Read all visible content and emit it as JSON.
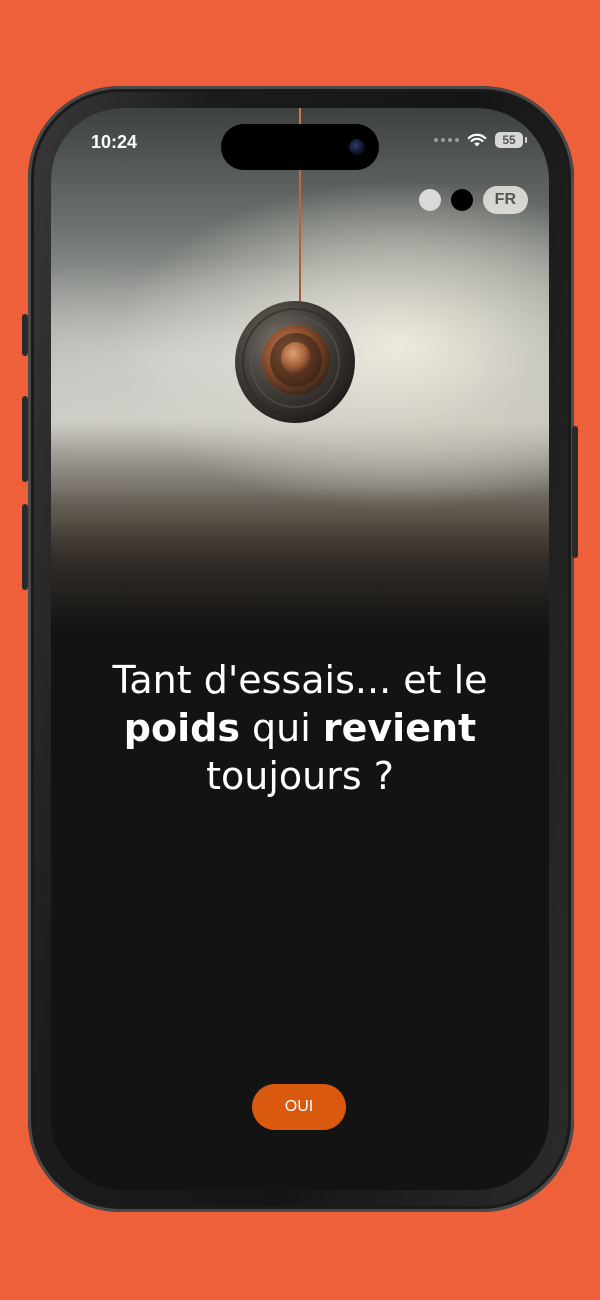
{
  "status_bar": {
    "time": "10:24",
    "battery": "55",
    "wifi_icon": "wifi-icon"
  },
  "controls": {
    "theme_light_color": "#d9d9d9",
    "theme_dark_color": "#000000",
    "language": "FR"
  },
  "question": {
    "line1": "Tant d'essais... et le",
    "bold1": "poids",
    "middle": "qui",
    "bold2": "revient",
    "line3": "toujours ?"
  },
  "cta": {
    "label": "OUI",
    "color": "#D9590E"
  },
  "colors": {
    "page_background": "#EE603A",
    "screen_background": "#131313"
  }
}
